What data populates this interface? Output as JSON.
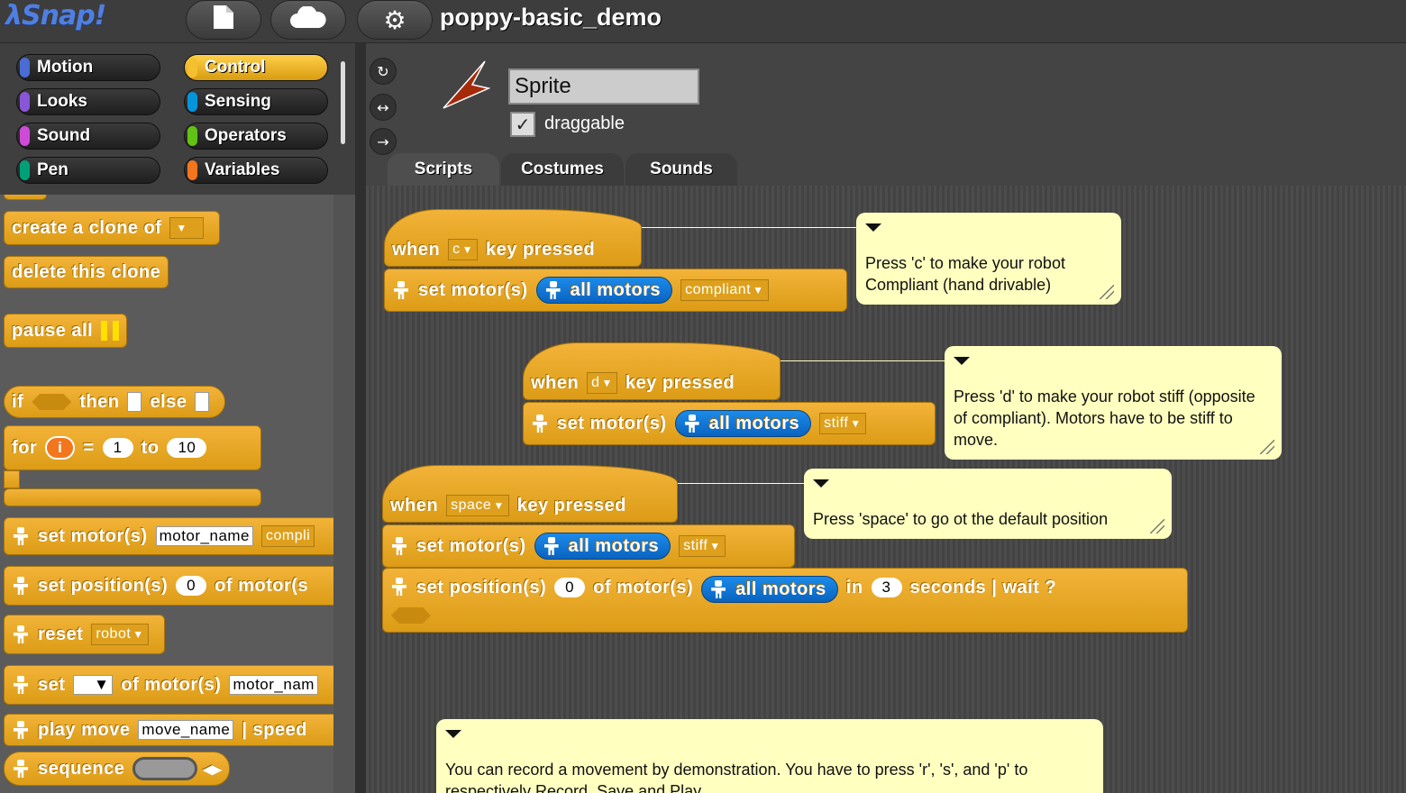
{
  "app": {
    "logo": "λSnap!",
    "project_title": "poppy-basic_demo"
  },
  "topbar": {
    "file_icon": "file-icon",
    "cloud_icon": "cloud-icon",
    "settings_icon": "gear-icon"
  },
  "categories": [
    {
      "label": "Motion",
      "color": "#4a6cd4"
    },
    {
      "label": "Control",
      "color": "#e6a822",
      "selected": true
    },
    {
      "label": "Looks",
      "color": "#8a55d7"
    },
    {
      "label": "Sensing",
      "color": "#0494dc"
    },
    {
      "label": "Sound",
      "color": "#cf4ad9"
    },
    {
      "label": "Operators",
      "color": "#62c213"
    },
    {
      "label": "Pen",
      "color": "#00a178"
    },
    {
      "label": "Variables",
      "color": "#f3761d"
    }
  ],
  "palette": {
    "create_clone": "create a clone of",
    "delete_clone": "delete this clone",
    "pause_all": "pause all",
    "if_word": "if",
    "then_word": "then",
    "else_word": "else",
    "for_word": "for",
    "for_var": "i",
    "eq": "=",
    "for_from": "1",
    "to_word": "to",
    "for_to": "10",
    "set_motors": "set motor(s)",
    "motor_name": "motor_name",
    "compliant_trunc": "compli",
    "set_positions": "set position(s)",
    "zero": "0",
    "of_motor": "of motor(s",
    "reset": "reset",
    "robot": "robot",
    "set_word": "set",
    "of_motors": "of motor(s)",
    "motor_nam": "motor_nam",
    "play_move": "play move",
    "move_name": "move_name",
    "speed": "| speed",
    "sequence": "sequence"
  },
  "sprite": {
    "name": "Sprite",
    "draggable_label": "draggable",
    "draggable_checked": "✓"
  },
  "tabs": {
    "scripts": "Scripts",
    "costumes": "Costumes",
    "sounds": "Sounds"
  },
  "scripts": {
    "when": "when",
    "key_pressed": "key pressed",
    "set_motors": "set motor(s)",
    "all_motors": "all motors",
    "key_c": "c",
    "key_d": "d",
    "key_space": "space",
    "compliant": "compliant",
    "stiff": "stiff",
    "set_positions": "set position(s)",
    "pos_value": "0",
    "of_motors": "of motor(s)",
    "in_word": "in",
    "duration": "3",
    "seconds_wait": "seconds | wait ?"
  },
  "notes": {
    "c": "Press 'c' to make your robot Compliant (hand drivable)",
    "d": "Press 'd' to make your robot stiff (opposite of compliant). Motors have to be stiff to move.",
    "space": "Press 'space' to go ot the default position",
    "record": "You can record a movement by demonstration. You have to press 'r', 's', and 'p' to respectively Record, Save and Play"
  }
}
